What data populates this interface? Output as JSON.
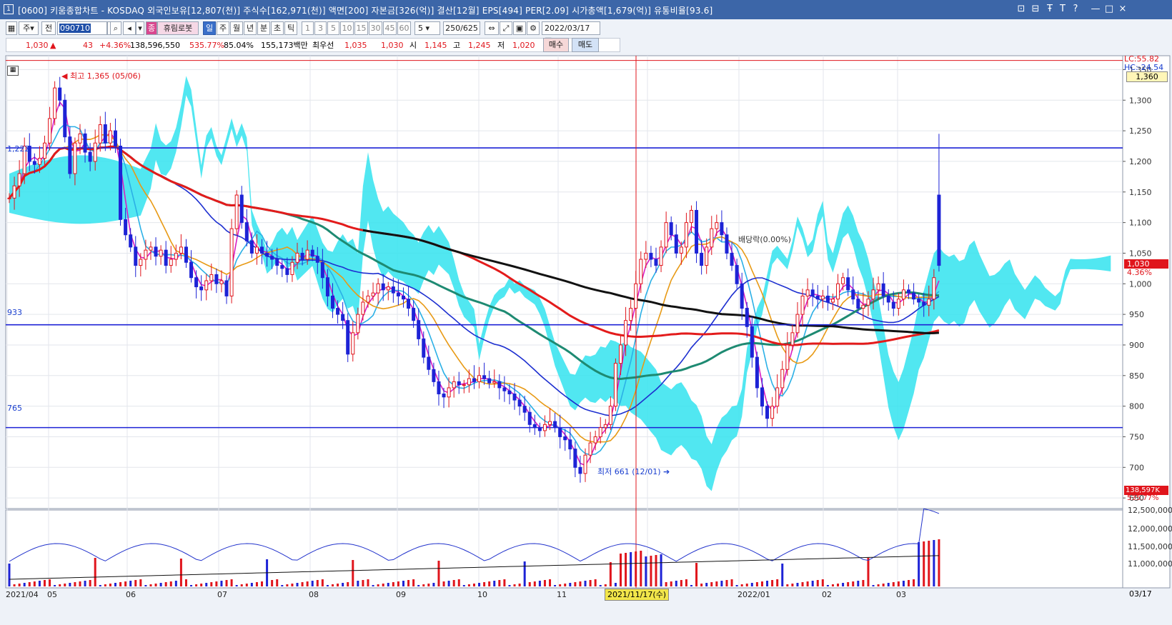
{
  "window": {
    "title": "[0600] 키움종합차트 - KOSDAQ 외국인보유[12,807(천)] 주식수[162,971(천)] 액면[200] 자본금[326(억)] 결산[12월] EPS[494] PER[2.09] 시가총액[1,679(억)] 유통비율[93.6]",
    "app_icon": "1",
    "controls": [
      "⊡",
      "⊟",
      "Ŧ",
      "T",
      "?",
      "—",
      "□",
      "×"
    ]
  },
  "toolbar": {
    "period_select": "주",
    "prev_label": "전",
    "code_value": "090710",
    "stock_name": "휴림로봇",
    "stock_badge": "종",
    "period_buttons": [
      "일",
      "주",
      "월",
      "년",
      "분",
      "초",
      "틱"
    ],
    "selected_period": "일",
    "interval_buttons": [
      "1",
      "3",
      "5",
      "10",
      "15",
      "30",
      "45",
      "60"
    ],
    "interval_value": "5",
    "count_value": "250",
    "count_total": "/625",
    "date_value": "2022/03/17"
  },
  "quote": {
    "price": "1,030",
    "change_arrow": "▲",
    "change": "43",
    "change_pct": "+4.36%",
    "volume": "138,596,550",
    "volume_ratio": "535.77%",
    "foreign_ratio": "85.04%",
    "amount": "155,173백만",
    "best_label": "최우선",
    "best_ask": "1,035",
    "best_bid": "1,030",
    "open_label": "시",
    "open": "1,145",
    "high_label": "고",
    "high": "1,245",
    "low_label": "저",
    "low": "1,020",
    "buy_label": "매수",
    "sell_label": "매도"
  },
  "chart_labels": {
    "high_marker": "최고 1,365 (05/06)",
    "low_marker": "최저 661 (12/01)",
    "dividend_marker": "배당락(0.00%)",
    "level_1222": "1,222",
    "level_933": "933",
    "level_765": "765",
    "lc_label": "LC:55.82",
    "hc_label": "HC:-24.54",
    "top_tag": "1,360",
    "price_tag": "1,030",
    "pct_tag": "4.36%",
    "vol_tag": "138,597K",
    "vol_pct_tag": "535.77%",
    "crosshair_date": "2021/11/17(수)",
    "end_date": "03/17"
  },
  "chart_data": {
    "type": "candlestick",
    "price_axis": {
      "ticks": [
        650,
        700,
        750,
        800,
        850,
        900,
        950,
        1000,
        1050,
        1100,
        1150,
        1200,
        1250,
        1300,
        1350
      ],
      "ylim": [
        635,
        1375
      ]
    },
    "volume_axis": {
      "ticks": [
        "11,000,000",
        "11,500,000",
        "12,000,000",
        "12,500,000"
      ]
    },
    "x_axis": {
      "ticks": [
        "2021/04",
        "05",
        "06",
        "07",
        "08",
        "09",
        "10",
        "11",
        "12",
        "2022/01",
        "02",
        "03"
      ]
    },
    "horizontal_lines": [
      1365,
      1222,
      933,
      765
    ],
    "key_points": [
      {
        "date": "2021/05/06",
        "high": 1365
      },
      {
        "date": "2021/12/01",
        "low": 661
      },
      {
        "date": "2022/03/17",
        "open": 1145,
        "high": 1245,
        "low": 1020,
        "close": 1030
      }
    ],
    "close_path": [
      1140,
      1160,
      1180,
      1225,
      1200,
      1195,
      1205,
      1230,
      1270,
      1320,
      1300,
      1240,
      1180,
      1230,
      1245,
      1215,
      1200,
      1230,
      1260,
      1230,
      1250,
      1225,
      1105,
      1080,
      1060,
      1030,
      1040,
      1055,
      1060,
      1045,
      1055,
      1030,
      1040,
      1050,
      1060,
      1035,
      1010,
      995,
      990,
      1005,
      1015,
      1000,
      1005,
      980,
      1090,
      1145,
      1100,
      1070,
      1050,
      1060,
      1050,
      1045,
      1040,
      1030,
      1025,
      1015,
      1035,
      1050,
      1040,
      1055,
      1045,
      1035,
      1010,
      980,
      960,
      950,
      940,
      885,
      920,
      950,
      970,
      980,
      985,
      1000,
      990,
      995,
      985,
      980,
      975,
      960,
      940,
      910,
      880,
      860,
      840,
      820,
      815,
      830,
      840,
      835,
      835,
      845,
      840,
      850,
      845,
      838,
      840,
      830,
      825,
      820,
      810,
      800,
      790,
      770,
      765,
      760,
      770,
      775,
      765,
      750,
      745,
      730,
      700,
      690,
      720,
      740,
      750,
      765,
      770,
      800,
      870,
      900,
      940,
      960,
      1000,
      1040,
      1050,
      1040,
      1030,
      1060,
      1100,
      1080,
      1050,
      1060,
      1100,
      1120,
      1050,
      1030,
      1060,
      1090,
      1100,
      1080,
      1050,
      1030,
      1000,
      960,
      930,
      880,
      830,
      800,
      780,
      800,
      830,
      860,
      900,
      920,
      950,
      980,
      990,
      980,
      975,
      980,
      970,
      975,
      1000,
      1010,
      990,
      975,
      960,
      965,
      975,
      990,
      1000,
      980,
      970,
      960,
      975,
      990,
      985,
      975,
      970,
      965,
      975,
      1010,
      1030
    ],
    "series": [
      {
        "name": "MA5",
        "color": "#d81cc4"
      },
      {
        "name": "MA10",
        "color": "#2bb0e6"
      },
      {
        "name": "MA20",
        "color": "#e89a15"
      },
      {
        "name": "MA60",
        "color": "#1d2fd0"
      },
      {
        "name": "MA120",
        "color": "#1e8a72"
      },
      {
        "name": "MA240",
        "color": "#e31b1b"
      },
      {
        "name": "MA480",
        "color": "#111111"
      }
    ]
  }
}
